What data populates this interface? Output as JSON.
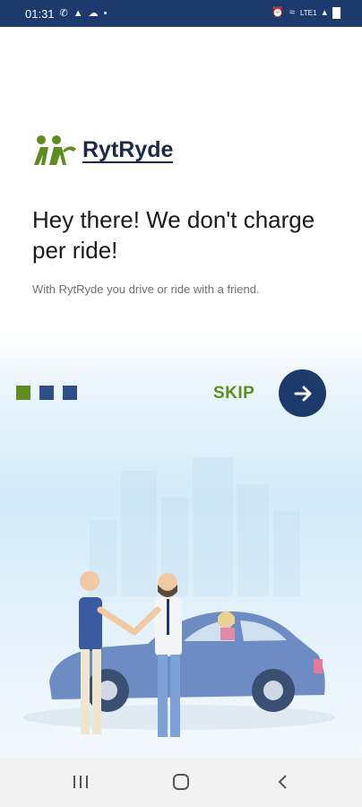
{
  "status_bar": {
    "time": "01:31",
    "left_icons": [
      "whatsapp-icon",
      "notification-icon",
      "cloud-icon",
      "dot-icon"
    ],
    "right_icons": [
      "alarm-icon",
      "wifi-icon",
      "lte-icon",
      "signal-icon",
      "battery-icon"
    ],
    "network_label": "LTE1"
  },
  "logo": {
    "brand": "RytRyde",
    "brand_color": "#5e8c1e"
  },
  "onboarding": {
    "headline": "Hey there! We don't charge per ride!",
    "subtext": "With RytRyde you drive or ride with a friend.",
    "page_indicator": {
      "count": 3,
      "active_index": 0,
      "active_color": "#5e8c1e",
      "inactive_color": "#2d4f86"
    },
    "skip_label": "SKIP",
    "next_icon": "arrow-right-icon"
  },
  "nav_bar": {
    "recents_icon": "recents-icon",
    "home_icon": "home-icon",
    "back_icon": "back-icon"
  },
  "colors": {
    "primary": "#1c3a6b",
    "accent": "#5e8c1e"
  }
}
